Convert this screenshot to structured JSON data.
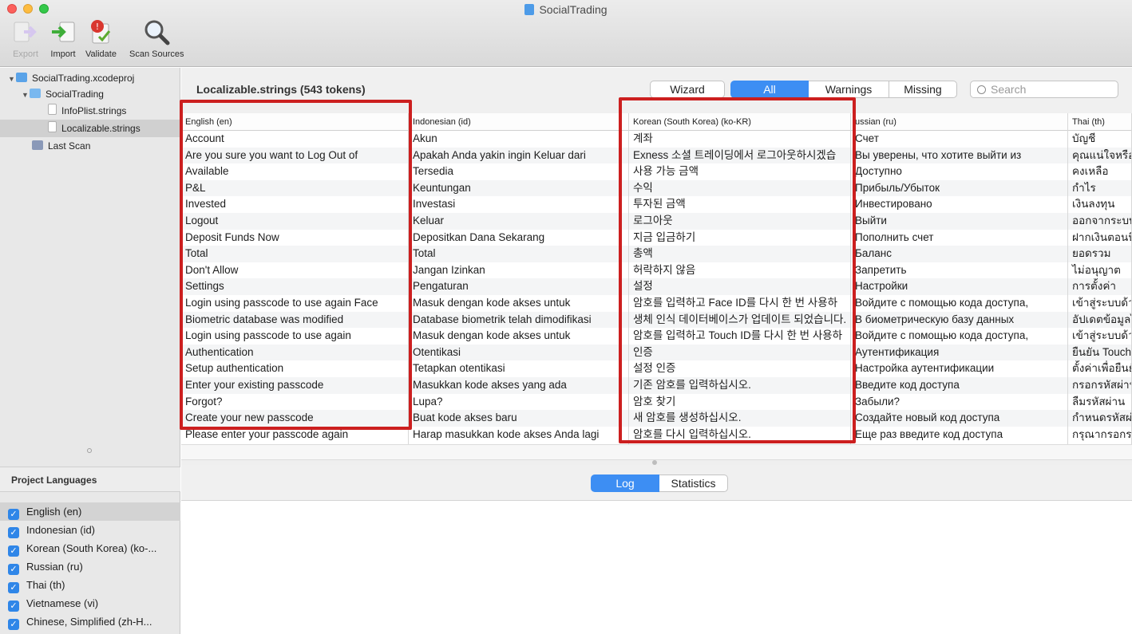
{
  "window": {
    "title": "SocialTrading"
  },
  "toolbar": [
    {
      "label": "Export",
      "icon": "export-icon",
      "enabled": false
    },
    {
      "label": "Import",
      "icon": "import-icon",
      "enabled": true
    },
    {
      "label": "Validate",
      "icon": "validate-icon",
      "enabled": true
    },
    {
      "label": "Scan Sources",
      "icon": "magnifier-icon",
      "enabled": true
    }
  ],
  "sidebar": {
    "tree": [
      {
        "label": "SocialTrading.xcodeproj",
        "icon": "xcodeproj-icon",
        "expanded": true
      },
      {
        "label": "SocialTrading",
        "icon": "folder-icon",
        "expanded": true
      },
      {
        "label": "InfoPlist.strings",
        "icon": "strings-file-icon"
      },
      {
        "label": "Localizable.strings",
        "icon": "strings-file-icon",
        "selected": true
      },
      {
        "label": "Last Scan",
        "icon": "scan-icon"
      }
    ],
    "languages_header": "Project Languages",
    "languages": [
      "English (en)",
      "Indonesian (id)",
      "Korean (South Korea) (ko-...",
      "Russian (ru)",
      "Thai (th)",
      "Vietnamese (vi)",
      "Chinese, Simplified (zh-H..."
    ]
  },
  "header": {
    "file_title": "Localizable.strings (543 tokens)",
    "wizard": "Wizard",
    "filters": [
      "All",
      "Warnings",
      "Missing"
    ],
    "active_filter": "All",
    "search_placeholder": "Search"
  },
  "table": {
    "columns": [
      {
        "header": "English (en)",
        "cells": [
          "Account",
          "Are you sure you want to Log Out of",
          "Available",
          "P&L",
          "Invested",
          "Logout",
          "Deposit Funds Now",
          "Total",
          "Don't Allow",
          "Settings",
          "Login using passcode to use again Face",
          "Biometric database was modified",
          "Login using passcode to use again",
          "Authentication",
          "Setup authentication",
          "Enter your existing passcode",
          "Forgot?",
          "Create your new passcode",
          "Please enter your passcode again"
        ]
      },
      {
        "header": "Indonesian (id)",
        "cells": [
          "Akun",
          "Apakah Anda yakin ingin Keluar dari",
          "Tersedia",
          "Keuntungan",
          "Investasi",
          "Keluar",
          "Depositkan Dana Sekarang",
          "Total",
          "Jangan Izinkan",
          "Pengaturan",
          "Masuk dengan kode akses untuk",
          "Database biometrik telah dimodifikasi",
          "Masuk dengan kode akses untuk",
          "Otentikasi",
          "Tetapkan otentikasi",
          "Masukkan kode akses yang ada",
          "Lupa?",
          "Buat kode akses baru",
          "Harap masukkan kode akses Anda lagi"
        ]
      },
      {
        "header": "Korean (South Korea) (ko-KR)",
        "cells": [
          "계좌",
          "Exness 소셜 트레이딩에서 로그아웃하시겠습",
          "사용 가능 금액",
          "수익",
          "투자된 금액",
          "로그아웃",
          "지금 입금하기",
          "총액",
          "허락하지 않음",
          "설정",
          "암호를 입력하고 Face ID를 다시 한 번 사용하",
          "생체 인식 데이터베이스가 업데이트 되었습니다.",
          "암호를 입력하고 Touch ID를 다시 한 번 사용하",
          "인증",
          "설정 인증",
          "기존 암호를 입력하십시오.",
          "암호 찾기",
          "새 암호를 생성하십시오.",
          "암호를 다시 입력하십시오."
        ]
      },
      {
        "header": "ussian (ru)",
        "cells": [
          "Счет",
          "Вы уверены, что хотите выйти из",
          "Доступно",
          "Прибыль/Убыток",
          "Инвестировано",
          "Выйти",
          "Пополнить счет",
          "Баланс",
          "Запретить",
          "Настройки",
          "Войдите с помощью кода доступа,",
          "В биометрическую базу данных",
          "Войдите с помощью кода доступа,",
          "Аутентификация",
          "Настройка аутентификации",
          "Введите код доступа",
          "Забыли?",
          "Создайте новый код доступа",
          "Еще раз введите код доступа"
        ]
      },
      {
        "header": "Thai (th)",
        "cells": [
          "บัญชี",
          "คุณแน่ใจหรือ",
          "คงเหลือ",
          "กำไร",
          "เงินลงทุน",
          "ออกจากระบบ",
          "ฝากเงินตอนนี้",
          "ยอดรวม",
          "ไม่อนุญาต",
          "การตั้งค่า",
          "เข้าสู่ระบบด้ว",
          "อัปเดตข้อมูลไ",
          "เข้าสู่ระบบด้ว",
          "ยืนยัน Touch",
          "ตั้งค่าเพื่อยืนยั",
          "กรอกรหัสผ่าน",
          "ลืมรหัสผ่าน",
          "กำหนดรหัสผ่",
          "กรุณากรอกร"
        ]
      }
    ]
  },
  "bottom": {
    "tabs": [
      "Log",
      "Statistics"
    ],
    "active_tab": "Log"
  },
  "colors": {
    "accent": "#3d8ef3",
    "highlight": "#cc1f1f",
    "sidebar": "#e8e8e8"
  }
}
